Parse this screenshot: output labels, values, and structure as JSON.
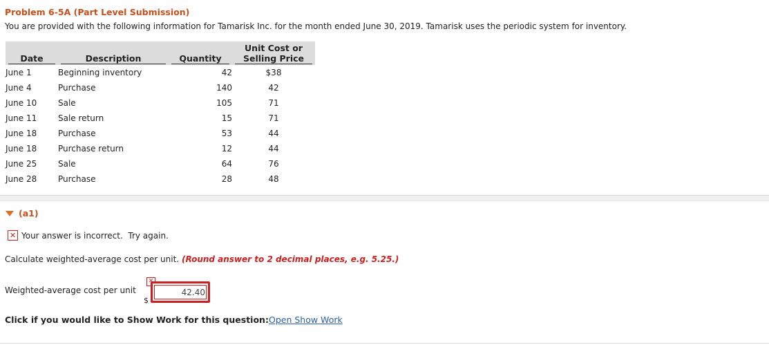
{
  "problem": {
    "title": "Problem 6-5A (Part Level Submission)",
    "intro": "You are provided with the following information for Tamarisk Inc. for the month ended June 30, 2019. Tamarisk uses the periodic system for inventory."
  },
  "table": {
    "headers": {
      "date": "Date",
      "description": "Description",
      "quantity": "Quantity",
      "unit_cost_line1": "Unit Cost or",
      "unit_cost_line2": "Selling Price"
    },
    "rows": [
      {
        "date": "June 1",
        "description": "Beginning inventory",
        "quantity": "42",
        "cost": "$38"
      },
      {
        "date": "June 4",
        "description": "Purchase",
        "quantity": "140",
        "cost": "42"
      },
      {
        "date": "June 10",
        "description": "Sale",
        "quantity": "105",
        "cost": "71"
      },
      {
        "date": "June 11",
        "description": "Sale return",
        "quantity": "15",
        "cost": "71"
      },
      {
        "date": "June 18",
        "description": "Purchase",
        "quantity": "53",
        "cost": "44"
      },
      {
        "date": "June 18",
        "description": "Purchase return",
        "quantity": "12",
        "cost": "44"
      },
      {
        "date": "June 25",
        "description": "Sale",
        "quantity": "64",
        "cost": "76"
      },
      {
        "date": "June 28",
        "description": "Purchase",
        "quantity": "28",
        "cost": "48"
      }
    ]
  },
  "part": {
    "label": "(a1)",
    "error_message": "Your answer is incorrect.  Try again.",
    "instruction": "Calculate weighted-average cost per unit.",
    "hint": "(Round answer to 2 decimal places, e.g. 5.25.)",
    "field_label": "Weighted-average cost per unit",
    "currency": "$",
    "answer_value": "42.40",
    "show_work_prompt": "Click if you would like to Show Work for this question:",
    "show_work_link": "Open Show Work"
  },
  "colors": {
    "title": "#c8501c",
    "error": "#cc1f1f",
    "link": "#2a5fa8"
  }
}
